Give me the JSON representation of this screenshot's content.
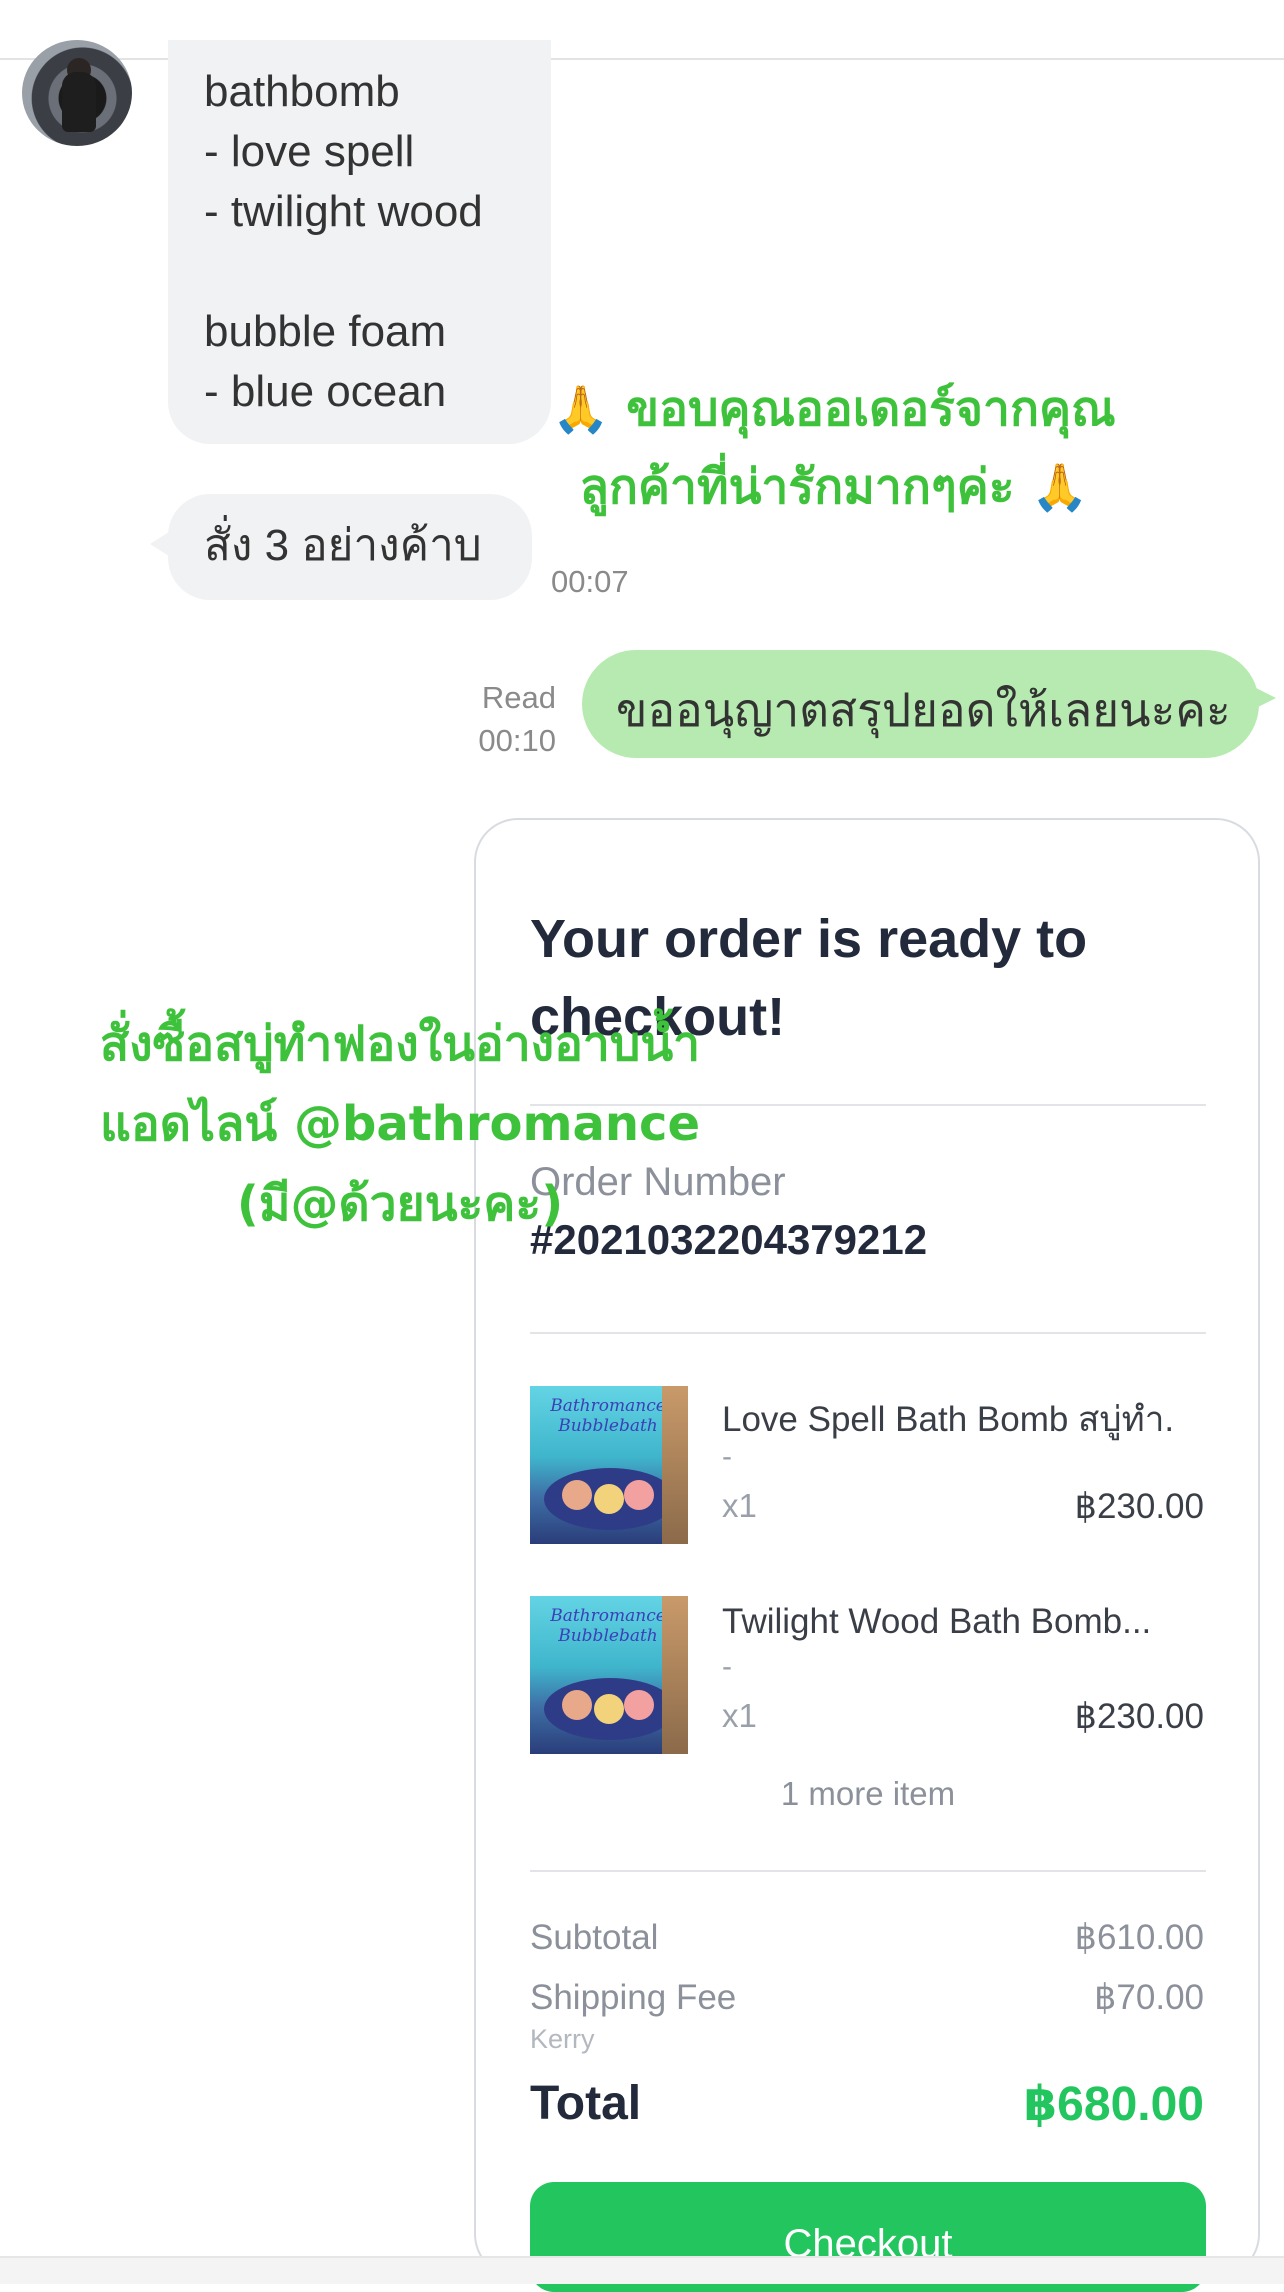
{
  "chat": {
    "incoming": {
      "message_1_text": "bathbomb\n- love spell\n- twilight wood\n\nbubble foam\n- blue ocean",
      "message_2_text": "สั่ง 3 อย่างค้าบ",
      "time": "00:07"
    },
    "outgoing": {
      "read_label": "Read",
      "time": "00:10",
      "message_text": "ขออนุญาตสรุปยอดให้เลยนะคะ"
    }
  },
  "overlay": {
    "thanks_line_1_emoji": "🙏",
    "thanks_line_1_text": " ขอบคุณออเดอร์จากคุณ",
    "thanks_line_2_text": "ลูกค้าที่น่ารักมากๆค่ะ ",
    "thanks_line_2_emoji": "🙏",
    "promo_line_1": "สั่งซื้อสบู่ทำฟองในอ่างอาบน้ำ",
    "promo_line_2": "แอดไลน์ @bathromance",
    "promo_line_3": "(มี@ด้วยนะคะ)"
  },
  "order": {
    "title": "Your order is ready to checkout!",
    "order_number_label": "Order Number",
    "order_number": "#2021032204379212",
    "items": [
      {
        "name": "Love Spell Bath Bomb สบู่ทำ.",
        "variant": "-",
        "qty": "x1",
        "price": "฿230.00",
        "image_brand": "Bathromance Bubblebath"
      },
      {
        "name": "Twilight Wood Bath Bomb...",
        "variant": "-",
        "qty": "x1",
        "price": "฿230.00",
        "image_brand": "Bathromance Bubblebath"
      }
    ],
    "more_items": "1 more item",
    "subtotal_label": "Subtotal",
    "subtotal_value": "฿610.00",
    "shipping_label": "Shipping Fee",
    "shipping_value": "฿70.00",
    "shipping_carrier": "Kerry",
    "total_label": "Total",
    "total_value": "฿680.00",
    "checkout_label": "Checkout"
  },
  "colors": {
    "outgoing_bubble": "#b7eab0",
    "incoming_bubble": "#f1f2f4",
    "accent_green": "#22c55e",
    "overlay_text": "#3ec13b"
  }
}
